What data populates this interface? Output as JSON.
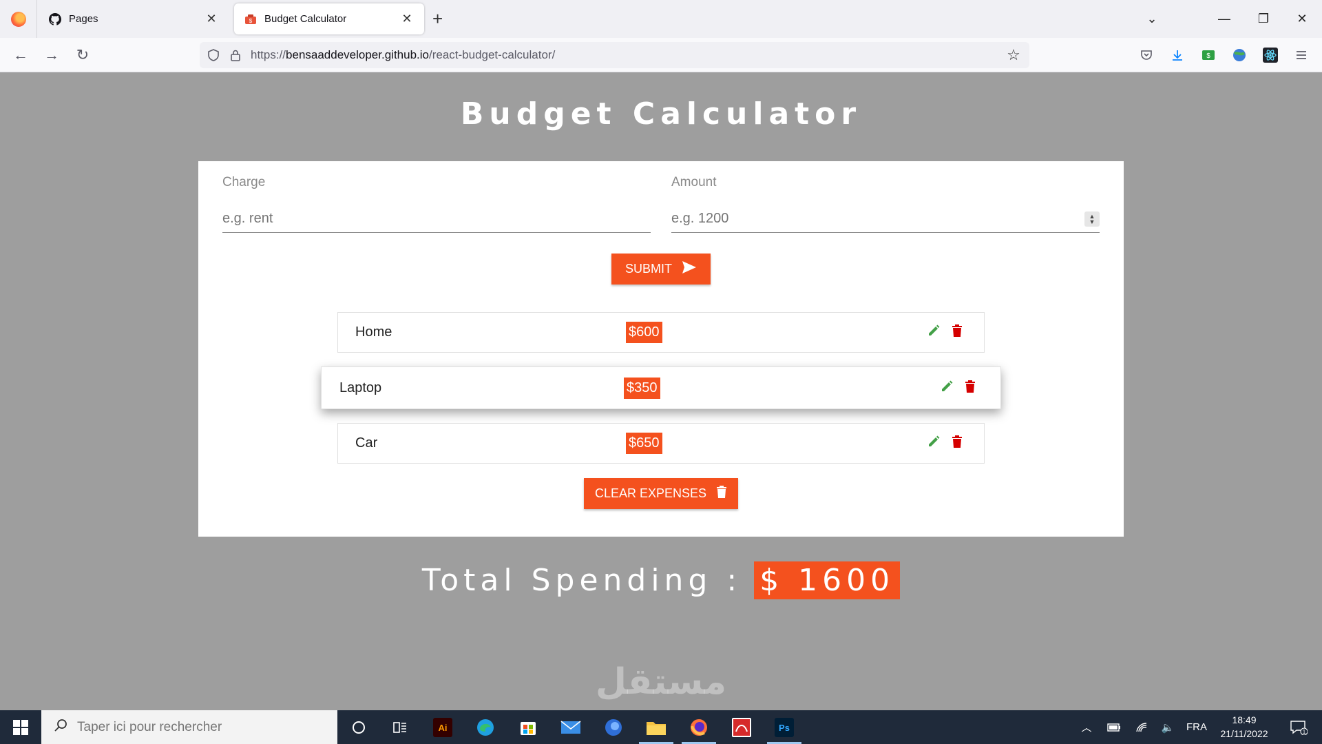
{
  "browser": {
    "tabs": [
      {
        "label": "Pages",
        "icon": "github-icon"
      },
      {
        "label": "Budget Calculator",
        "icon": "money-bag-icon"
      }
    ],
    "url_scheme": "https://",
    "url_host": "bensaaddeveloper.github.io",
    "url_path": "/react-budget-calculator/"
  },
  "app": {
    "title": "Budget Calculator",
    "charge_label": "Charge",
    "charge_placeholder": "e.g. rent",
    "amount_label": "Amount",
    "amount_placeholder": "e.g. 1200",
    "submit_label": "SUBMIT",
    "expenses": [
      {
        "name": "Home",
        "amount": "$600"
      },
      {
        "name": "Laptop",
        "amount": "$350"
      },
      {
        "name": "Car",
        "amount": "$650"
      }
    ],
    "clear_label": "CLEAR EXPENSES",
    "total_label": "Total Spending :",
    "total_value": "$ 1600",
    "accent_color": "#f4511e",
    "edit_color": "#43a047",
    "delete_color": "#d50000"
  },
  "watermark": "مستقل",
  "taskbar": {
    "search_placeholder": "Taper ici pour rechercher",
    "language": "FRA",
    "time": "18:49",
    "date": "21/11/2022",
    "notifications": "1"
  }
}
